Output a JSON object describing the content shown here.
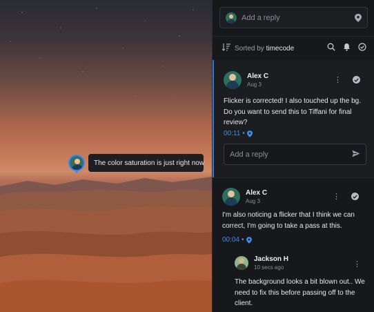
{
  "viewer": {
    "tooltip": "The color saturation is just right now"
  },
  "panel": {
    "reply_placeholder": "Add a reply",
    "sort_prefix": "Sorted by",
    "sort_value": "timecode",
    "icons": [
      "sort-icon",
      "search-icon",
      "bell-icon",
      "check-circle-icon"
    ]
  },
  "comments": [
    {
      "author": "Alex C",
      "date": "Aug 3",
      "text": "Flicker is corrected! I also touched up the bg. Do you want to send this to Tiffani for final review?",
      "timecode": "00:11",
      "reply_placeholder": "Add a reply"
    },
    {
      "author": "Alex C",
      "date": "Aug 3",
      "text": "I'm also noticing a flicker that I think we can correct, I'm going to take a pass at this.",
      "timecode": "00:04",
      "reply": {
        "author": "Jackson H",
        "date": "10 secs ago",
        "text": "The background looks a bit blown out.. We need to fix this before passing off to the client."
      }
    }
  ],
  "colors": {
    "accent": "#2f7ad6",
    "timecode": "#3d8fe8",
    "panel_bg": "#17181b"
  }
}
